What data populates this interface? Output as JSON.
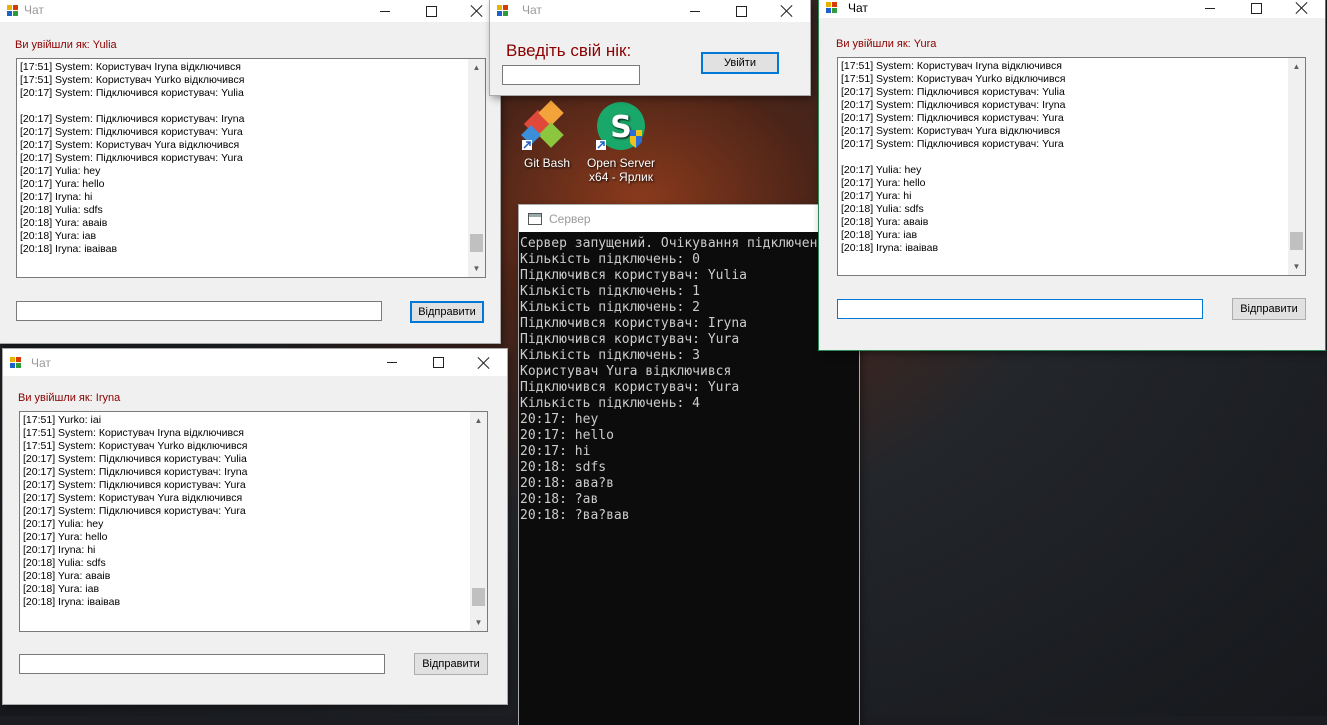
{
  "desktop": {
    "icons": [
      {
        "label_line1": "Git Bash",
        "label_line2": ""
      },
      {
        "label_line1": "Open Server",
        "label_line2": "x64 - Ярлик"
      }
    ]
  },
  "login_window": {
    "title": "Чат",
    "prompt": "Введіть свій нік:",
    "nick_value": "",
    "login_button": "Увійти"
  },
  "server_window": {
    "title": "Сервер",
    "lines": [
      "Сервер запущений. Очікування підключен",
      "Кількість підключень: 0",
      "Підключився користувач: Yulia",
      "Кількість підключень: 1",
      "Кількість підключень: 2",
      "Підключився користувач: Iryna",
      "Підключився користувач: Yura",
      "Кількість підключень: 3",
      "Користувач Yura відключився",
      "Підключився користувач: Yura",
      "Кількість підключень: 4",
      "20:17: hey",
      "20:17: hello",
      "20:17: hi",
      "20:18: sdfs",
      "20:18: ава?в",
      "20:18: ?ав",
      "20:18: ?ва?вав"
    ]
  },
  "chat_yulia": {
    "title": "Чат",
    "logged_in_as": "Ви увійшли як: Yulia",
    "messages": [
      "[17:51] System: Користувач Iryna відключився",
      "[17:51] System: Користувач Yurko відключився",
      "[20:17] System: Підключився користувач: Yulia",
      "",
      "[20:17] System: Підключився користувач: Iryna",
      "[20:17] System: Підключився користувач: Yura",
      "[20:17] System: Користувач Yura відключився",
      "[20:17] System: Підключився користувач: Yura",
      "[20:17] Yulia: hey",
      "[20:17] Yura: hello",
      "[20:17] Iryna: hi",
      "[20:18] Yulia: sdfs",
      "[20:18] Yura: аваів",
      "[20:18] Yura: іав",
      "[20:18] Iryna: іваівав"
    ],
    "input_value": "",
    "send_button": "Відправити",
    "scroll_position": 0.95
  },
  "chat_iryna": {
    "title": "Чат",
    "logged_in_as": "Ви увійшли як: Iryna",
    "messages": [
      "[17:51] Yurko: іаі",
      "[17:51] System: Користувач Iryna відключився",
      "[17:51] System: Користувач Yurko відключився",
      "[20:17] System: Підключився користувач: Yulia",
      "[20:17] System: Підключився користувач: Iryna",
      "[20:17] System: Підключився користувач: Yura",
      "[20:17] System: Користувач Yura відключився",
      "[20:17] System: Підключився користувач: Yura",
      "[20:17] Yulia: hey",
      "[20:17] Yura: hello",
      "[20:17] Iryna: hi",
      "[20:18] Yulia: sdfs",
      "[20:18] Yura: аваів",
      "[20:18] Yura: іав",
      "[20:18] Iryna: іваівав"
    ],
    "input_value": "",
    "send_button": "Відправити",
    "scroll_position": 0.95
  },
  "chat_yura": {
    "title": "Чат",
    "logged_in_as": "Ви увійшли як: Yura",
    "messages": [
      "[17:51] System: Користувач Iryna відключився",
      "[17:51] System: Користувач Yurko відключився",
      "[20:17] System: Підключився користувач: Yulia",
      "[20:17] System: Підключився користувач: Iryna",
      "[20:17] System: Підключився користувач: Yura",
      "[20:17] System: Користувач Yura відключився",
      "[20:17] System: Підключився користувач: Yura",
      "",
      "[20:17] Yulia: hey",
      "[20:17] Yura: hello",
      "[20:17] Yura: hi",
      "[20:18] Yulia: sdfs",
      "[20:18] Yura: аваів",
      "[20:18] Yura: іав",
      "[20:18] Iryna: іваівав"
    ],
    "input_value": "",
    "send_button": "Відправити",
    "scroll_position": 0.95
  },
  "colors": {
    "login_label": "#8b0000",
    "console_bg": "#0c0c0c",
    "console_text": "#cccccc",
    "focus_blue": "#0078d7"
  }
}
